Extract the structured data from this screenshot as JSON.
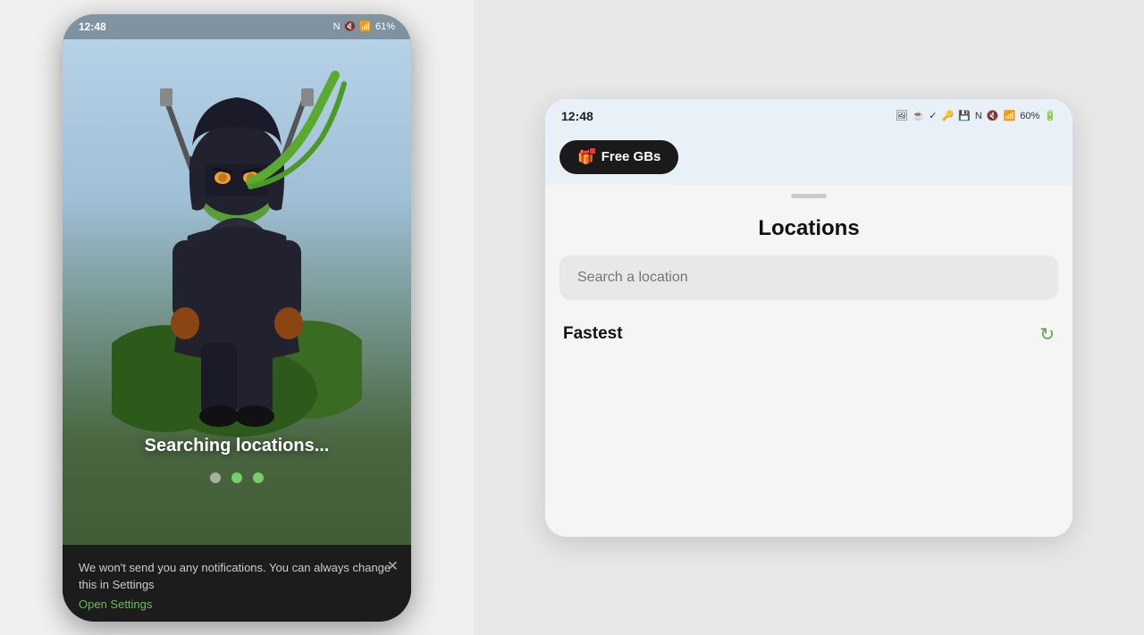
{
  "left_phone": {
    "status_time": "12:48",
    "status_icons": "■ ✓",
    "battery": "61%",
    "searching_text": "Searching locations...",
    "dots": [
      {
        "active": false
      },
      {
        "active": true
      },
      {
        "active": true
      }
    ],
    "notification": {
      "text": "We won't send you any notifications.\nYou can always change this in Settings",
      "link": "Open Settings",
      "close_icon": "✕"
    }
  },
  "right_phone": {
    "status_time": "12:48",
    "status_icons_left": "🖼 ☕ ✓",
    "status_icons_right": "60%",
    "free_gbs_label": "Free GBs",
    "free_gbs_dot_color": "#e53935",
    "sheet": {
      "title": "Locations",
      "search_placeholder": "Search a location",
      "fastest_label": "Fastest"
    }
  },
  "icons": {
    "gift": "🎁",
    "refresh": "↻",
    "close": "✕"
  }
}
